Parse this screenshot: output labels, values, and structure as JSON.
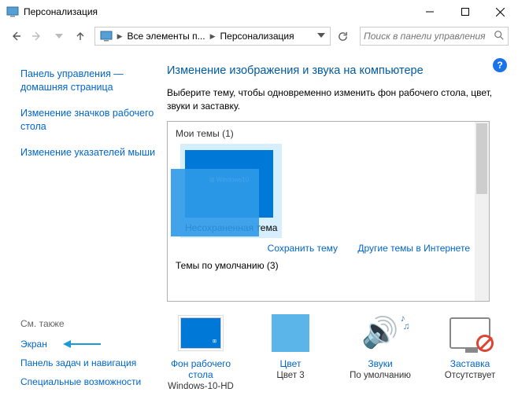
{
  "title": "Персонализация",
  "breadcrumb": {
    "item1": "Все элементы п...",
    "item2": "Персонализация"
  },
  "search": {
    "placeholder": "Поиск в панели управления"
  },
  "sidebar": {
    "home": "Панель управления — домашняя страница",
    "link1": "Изменение значков рабочего стола",
    "link2": "Изменение указателей мыши",
    "seeAlso": "См. также",
    "rel1": "Экран",
    "rel2": "Панель задач и навигация",
    "rel3": "Специальные возможности"
  },
  "main": {
    "heading": "Изменение изображения и звука на компьютере",
    "sub": "Выберите тему, чтобы одновременно изменить фон рабочего стола, цвет, звуки и заставку.",
    "myThemes": "Мои темы (1)",
    "themeLabel": "Несохраненная тема",
    "saveTheme": "Сохранить тему",
    "moreThemes": "Другие темы в Интернете",
    "defaultThemes": "Темы по умолчанию (3)"
  },
  "tiles": {
    "bg": {
      "label": "Фон рабочего стола",
      "value": "Windows-10-HD"
    },
    "color": {
      "label": "Цвет",
      "value": "Цвет 3"
    },
    "sound": {
      "label": "Звуки",
      "value": "По умолчанию"
    },
    "saver": {
      "label": "Заставка",
      "value": "Отсутствует"
    }
  }
}
